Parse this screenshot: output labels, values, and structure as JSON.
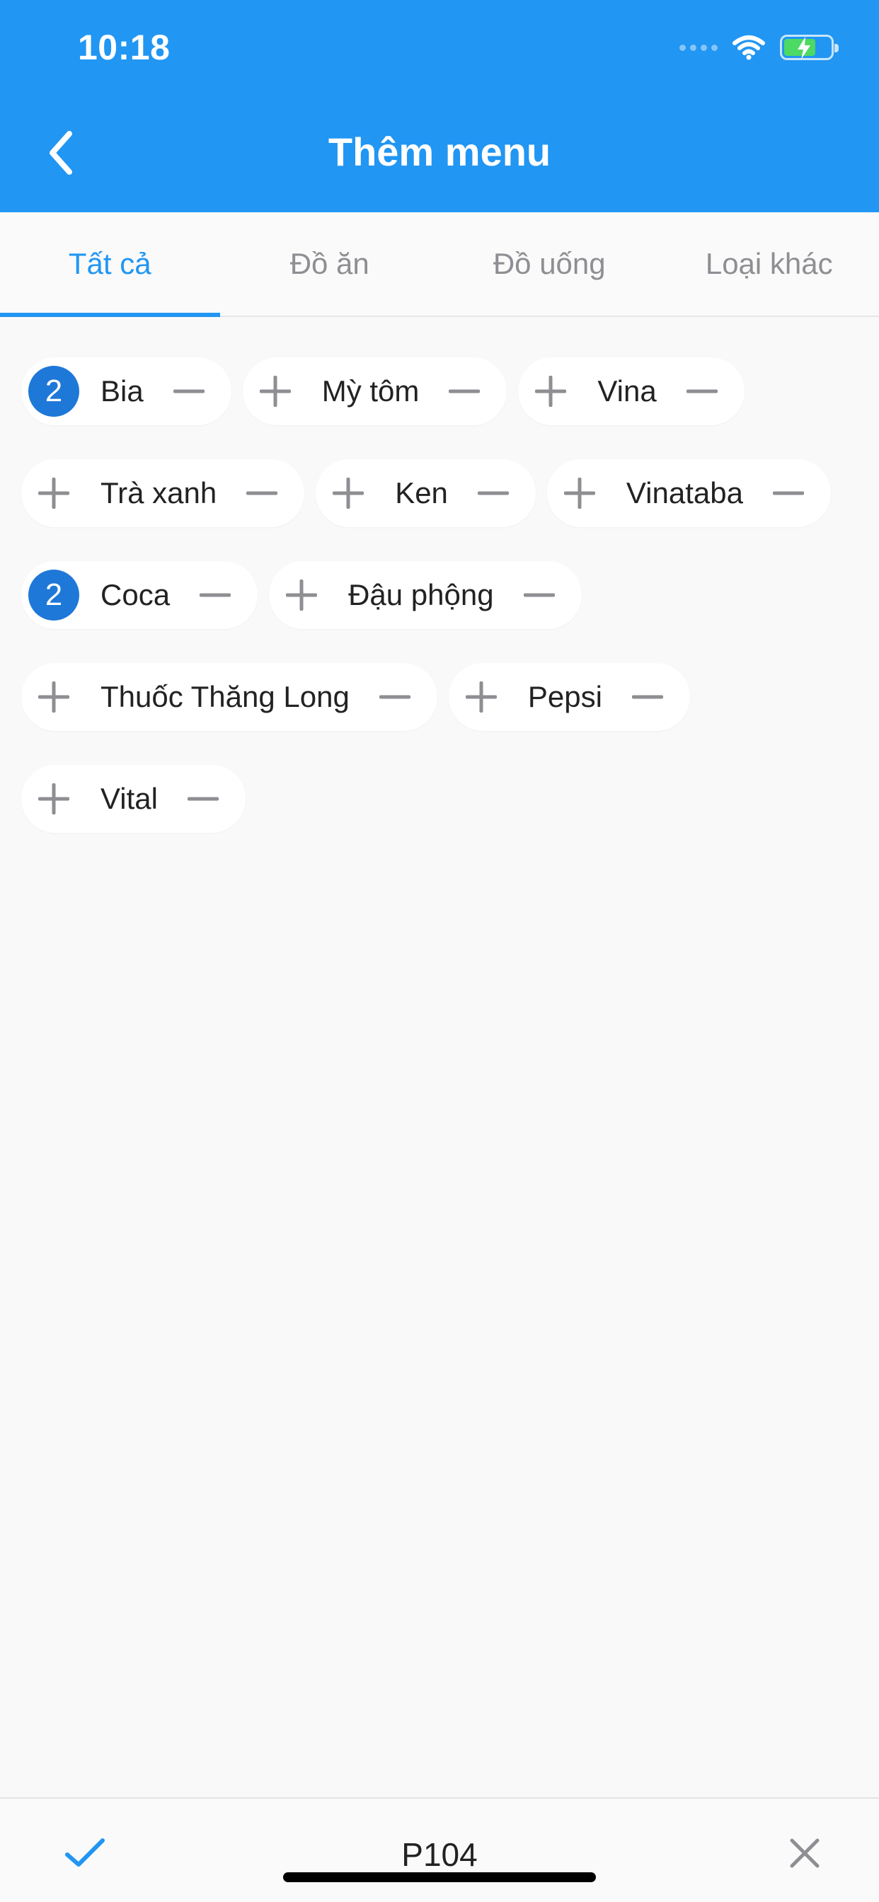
{
  "status_bar": {
    "time": "10:18"
  },
  "header": {
    "title": "Thêm menu"
  },
  "tabs": [
    {
      "label": "Tất cả",
      "active": true
    },
    {
      "label": "Đồ ăn",
      "active": false
    },
    {
      "label": "Đồ uống",
      "active": false
    },
    {
      "label": "Loại khác",
      "active": false
    }
  ],
  "items": [
    {
      "label": "Bia",
      "count": "2"
    },
    {
      "label": "Mỳ tôm",
      "count": null
    },
    {
      "label": "Vina",
      "count": null
    },
    {
      "label": "Trà xanh",
      "count": null
    },
    {
      "label": "Ken",
      "count": null
    },
    {
      "label": "Vinataba",
      "count": null
    },
    {
      "label": "Coca",
      "count": "2"
    },
    {
      "label": "Đậu phộng",
      "count": null
    },
    {
      "label": "Thuốc Thăng Long",
      "count": null
    },
    {
      "label": "Pepsi",
      "count": null
    },
    {
      "label": "Vital",
      "count": null
    }
  ],
  "bottom_bar": {
    "room": "P104"
  },
  "colors": {
    "primary": "#2196f3",
    "badge": "#1e78d8",
    "icon_gray": "#8e8e93"
  }
}
